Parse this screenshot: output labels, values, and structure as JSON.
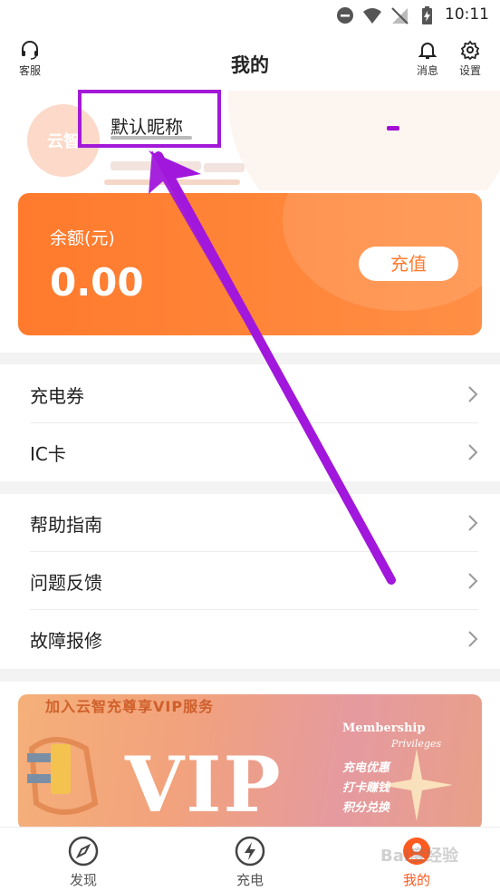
{
  "status_bar": {
    "time": "10:11"
  },
  "header": {
    "title": "我的",
    "left_button": {
      "label": "客服",
      "icon": "headset-icon"
    },
    "right_buttons": [
      {
        "label": "消息",
        "icon": "bell-icon"
      },
      {
        "label": "设置",
        "icon": "gear-icon"
      }
    ]
  },
  "profile": {
    "nickname": "默认昵称",
    "avatar_text": "云智"
  },
  "balance": {
    "label": "余额(元)",
    "value": "0.00",
    "recharge_label": "充值"
  },
  "menu_groups": [
    [
      {
        "label": "充电券"
      },
      {
        "label": "IC卡"
      }
    ],
    [
      {
        "label": "帮助指南"
      },
      {
        "label": "问题反馈"
      },
      {
        "label": "故障报修"
      }
    ]
  ],
  "vip_banner": {
    "headline": "加入云智充尊享VIP服务",
    "big_text": "VIP",
    "membership": "Membership",
    "privileges": "Privileges",
    "features": [
      "充电优惠",
      "打卡赚钱",
      "积分兑换"
    ]
  },
  "tabbar": {
    "items": [
      {
        "label": "发现",
        "icon": "compass-icon",
        "active": false
      },
      {
        "label": "充电",
        "icon": "lightning-icon",
        "active": false
      },
      {
        "label": "我的",
        "icon": "profile-icon",
        "active": true
      }
    ]
  },
  "watermark": "Bai度经验",
  "colors": {
    "accent": "#ff7a2c",
    "annotation": "#a419d8",
    "active_tab": "#ff5a1f"
  }
}
